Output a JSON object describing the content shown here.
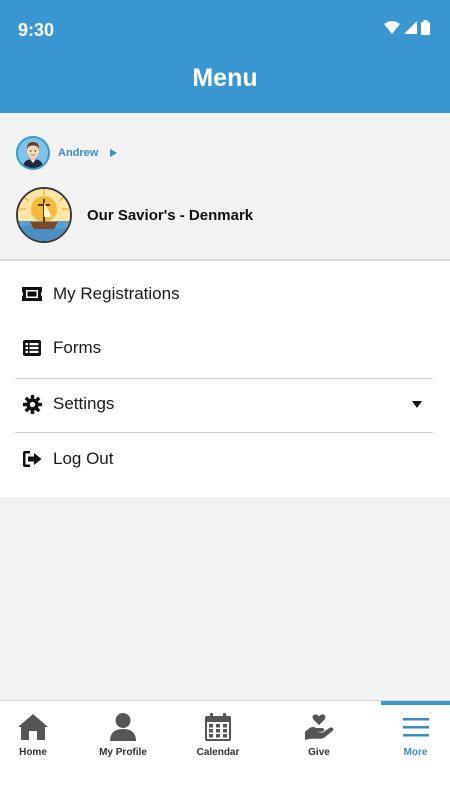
{
  "status_bar": {
    "time": "9:30",
    "icons": [
      "wifi-icon",
      "signal-icon",
      "battery-icon"
    ]
  },
  "header": {
    "title": "Menu",
    "color": "#3a96d0"
  },
  "account": {
    "user_name": "Andrew",
    "church_name": "Our Savior's - Denmark"
  },
  "menu": {
    "items": [
      {
        "label": "My Registrations",
        "icon": "ticket-icon"
      },
      {
        "label": "Forms",
        "icon": "list-icon"
      },
      {
        "label": "Settings",
        "icon": "gear-icon"
      },
      {
        "label": "Log Out",
        "icon": "logout-icon"
      }
    ]
  },
  "bottom_nav": {
    "items": [
      {
        "label": "Home",
        "icon": "home-icon"
      },
      {
        "label": "My Profile",
        "icon": "person-icon"
      },
      {
        "label": "Calendar",
        "icon": "calendar-icon"
      },
      {
        "label": "Give",
        "icon": "give-icon"
      },
      {
        "label": "More",
        "icon": "hamburger-icon"
      }
    ],
    "active": "More",
    "accent": "#3a8cc3"
  }
}
